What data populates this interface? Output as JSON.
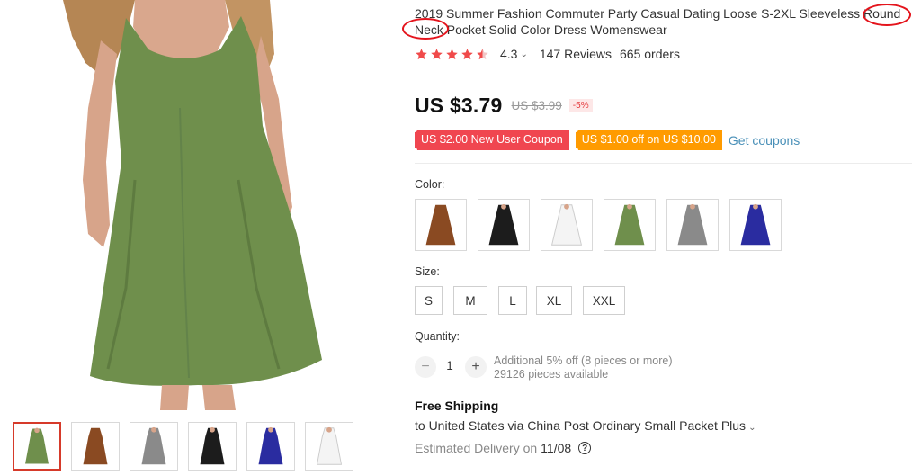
{
  "product": {
    "title": "2019 Summer Fashion Commuter Party Casual Dating Loose S-2XL Sleeveless Round Neck Pocket Solid Color Dress Womenswear",
    "title_line1": "2019 Summer Fashion Commuter Party Casual Dating Loose S-2XL Sleeveless Round",
    "title_line2": "Neck Pocket Solid Color Dress Womenswear",
    "main_image": "model wearing green sleeveless dress",
    "thumbnails": [
      {
        "name": "green-dress-thumb",
        "color": "#6f8f4c"
      },
      {
        "name": "brown-dress-thumb",
        "color": "#8a4a22"
      },
      {
        "name": "gray-dress-thumb",
        "color": "#8a8a8a"
      },
      {
        "name": "black-dress-thumb",
        "color": "#1c1c1c"
      },
      {
        "name": "blue-dress-thumb",
        "color": "#2a2ca0"
      },
      {
        "name": "white-dress-thumb",
        "color": "#f4f4f4"
      }
    ]
  },
  "rating": {
    "stars": 4.3,
    "value": "4.3",
    "reviews": "147 Reviews",
    "orders": "665 orders",
    "star_color": "#f04a4a"
  },
  "pricing": {
    "price": "US $3.79",
    "original": "US $3.99",
    "discount": "-5%"
  },
  "coupons": {
    "new_user": "US $2.00 New User Coupon",
    "store": "US $1.00 off on US $10.00",
    "get_label": "Get coupons",
    "new_user_color": "#f04650",
    "store_color": "#ff9b00"
  },
  "color_section": {
    "label": "Color:",
    "options": [
      {
        "name": "brown",
        "color": "#8a4a22"
      },
      {
        "name": "black",
        "color": "#1c1c1c"
      },
      {
        "name": "white",
        "color": "#f4f4f4"
      },
      {
        "name": "green",
        "color": "#6f8f4c"
      },
      {
        "name": "gray",
        "color": "#8a8a8a"
      },
      {
        "name": "blue",
        "color": "#2a2ca0"
      }
    ]
  },
  "size_section": {
    "label": "Size:",
    "options": [
      "S",
      "M",
      "L",
      "XL",
      "XXL"
    ]
  },
  "quantity": {
    "label": "Quantity:",
    "value": "1",
    "minus": "−",
    "plus": "+",
    "bulk_note": "Additional 5% off (8 pieces or more)",
    "available": "29126 pieces available"
  },
  "shipping": {
    "title": "Free Shipping",
    "detail": "to United States via China Post Ordinary Small Packet Plus",
    "delivery_label": "Estimated Delivery on",
    "delivery_date": "11/08",
    "help_icon": "?"
  },
  "annotations": {
    "ring_color": "#e4141c"
  }
}
